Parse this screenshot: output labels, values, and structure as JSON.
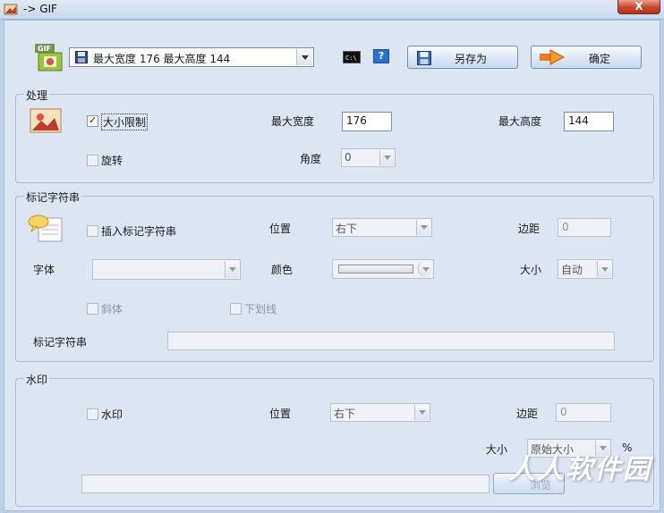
{
  "window": {
    "title": "-> GIF",
    "close_label": "X"
  },
  "toolbar": {
    "size_combo_value": "最大宽度 176 最大高度 144",
    "cmd_icon": "cmd-icon",
    "help_label": "?",
    "save_as_label": "另存为",
    "ok_label": "确定"
  },
  "process": {
    "title": "处理",
    "size_limit_label": "大小限制",
    "size_limit_checked": true,
    "max_width_label": "最大宽度",
    "max_width_value": "176",
    "max_height_label": "最大高度",
    "max_height_value": "144",
    "rotate_label": "旋转",
    "rotate_checked": false,
    "angle_label": "角度",
    "angle_value": "0"
  },
  "mark": {
    "title": "标记字符串",
    "insert_label": "插入标记字符串",
    "position_label": "位置",
    "position_value": "右下",
    "margin_label": "边距",
    "margin_value": "0",
    "font_label": "字体",
    "font_value": "",
    "color_label": "颜色",
    "size_label": "大小",
    "size_value": "自动",
    "italic_label": "斜体",
    "underline_label": "下划线",
    "string_label": "标记字符串",
    "string_value": ""
  },
  "watermark": {
    "title": "水印",
    "enable_label": "水印",
    "position_label": "位置",
    "position_value": "右下",
    "margin_label": "边距",
    "margin_value": "0",
    "size_label": "大小",
    "size_value": "原始大小",
    "percent_label": "%",
    "browse_label": "浏览"
  },
  "overlay": {
    "site_watermark": "人人软件园"
  },
  "colors": {
    "accent": "#2a6fd6",
    "group_border": "#aabfd8",
    "background": "#dce6f3"
  }
}
